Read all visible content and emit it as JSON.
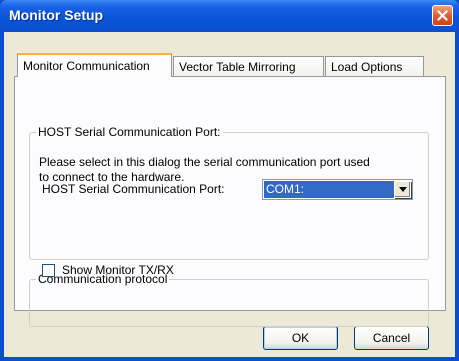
{
  "window": {
    "title": "Monitor Setup"
  },
  "tabs": [
    {
      "label": "Monitor Communication",
      "active": true
    },
    {
      "label": "Vector Table Mirroring",
      "active": false
    },
    {
      "label": "Load Options",
      "active": false
    }
  ],
  "host_group": {
    "legend": "HOST Serial Communication Port:",
    "description_line1": "Please select in this dialog the serial communication port used",
    "description_line2": "to connect to the hardware.",
    "port_label": "HOST Serial Communication Port:",
    "port_value": "COM1:"
  },
  "protocol_group": {
    "legend": "Communication protocol",
    "checkbox_label": "Show Monitor TX/RX",
    "checked": false
  },
  "buttons": {
    "ok": "OK",
    "cancel": "Cancel"
  },
  "icons": {
    "close": "close-icon",
    "dropdown": "chevron-down-icon"
  }
}
